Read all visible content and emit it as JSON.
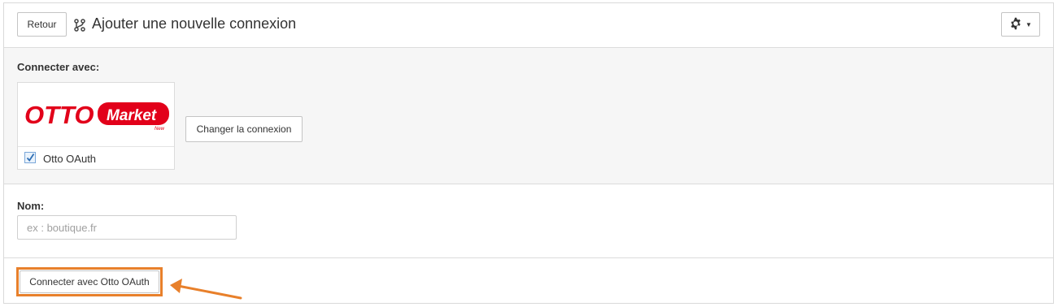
{
  "header": {
    "back_label": "Retour",
    "title": "Ajouter une nouvelle connexion",
    "title_icon": "connection-icon",
    "settings_icon": "gear-icon"
  },
  "connect": {
    "label": "Connecter avec:",
    "card": {
      "logo": {
        "brand": "OTTO",
        "badge": "Market",
        "badge_tag": "New"
      },
      "checkbox_checked": true,
      "checkbox_label": "Otto OAuth"
    },
    "change_label": "Changer la connexion"
  },
  "name": {
    "label": "Nom:",
    "placeholder": "ex : boutique.fr",
    "value": ""
  },
  "footer": {
    "oauth_button_label": "Connecter avec Otto OAuth",
    "highlight_color": "#e8802b"
  },
  "colors": {
    "brand_red": "#e2001a",
    "accent_orange": "#e8802b"
  }
}
